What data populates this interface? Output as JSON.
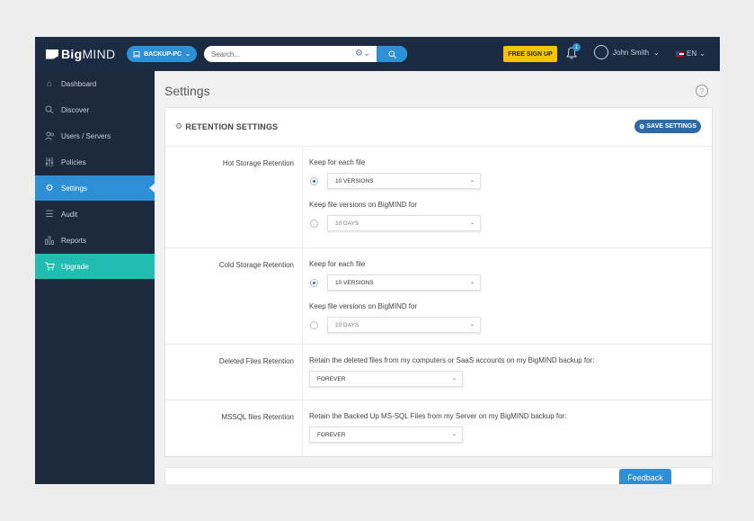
{
  "brand": {
    "bold": "Big",
    "light": "MIND"
  },
  "header": {
    "device_label": "BACKUP-PC",
    "search_placeholder": "Search...",
    "free_signup_label": "FREE SIGN UP",
    "notification_count": "1",
    "user_name": "John Smith",
    "language": "EN"
  },
  "sidebar": {
    "items": [
      {
        "label": "Dashboard",
        "icon": "home-icon"
      },
      {
        "label": "Discover",
        "icon": "search-icon"
      },
      {
        "label": "Users / Servers",
        "icon": "users-icon"
      },
      {
        "label": "Policies",
        "icon": "sliders-icon"
      },
      {
        "label": "Settings",
        "icon": "gear-icon",
        "active": true
      },
      {
        "label": "Audit",
        "icon": "list-icon"
      },
      {
        "label": "Reports",
        "icon": "bar-chart-icon"
      },
      {
        "label": "Upgrade",
        "icon": "cart-icon"
      }
    ]
  },
  "page": {
    "title": "Settings"
  },
  "panel": {
    "title": "RETENTION SETTINGS",
    "save_label": "SAVE SETTINGS",
    "hot": {
      "label": "Hot Storage Retention",
      "keep_each": "Keep for each file",
      "versions_value": "10 VERSIONS",
      "keep_versions": "Keep file versions on BigMIND for",
      "days_value": "10 DAYS"
    },
    "cold": {
      "label": "Cold Storage Retention",
      "keep_each": "Keep for each file",
      "versions_value": "10 VERSIONS",
      "keep_versions": "Keep file versions on BigMIND for",
      "days_value": "10 DAYS"
    },
    "deleted": {
      "label": "Deleted Files Retention",
      "desc": "Retain the deleted files from my computers or SaaS accounts on my BigMIND backup for:",
      "value": "FOREVER"
    },
    "mssql": {
      "label": "MSSQL files Retention",
      "desc": "Retain the Backed Up MS-SQL Files from my Server on my BigMIND backup for:",
      "value": "FOREVER"
    }
  },
  "feedback_label": "Feedback",
  "colors": {
    "topbar": "#1b2b42",
    "sidebar": "#1d2a3e",
    "accent": "#2d8fd5",
    "upgrade": "#21bdb0",
    "signup": "#f5c300"
  }
}
